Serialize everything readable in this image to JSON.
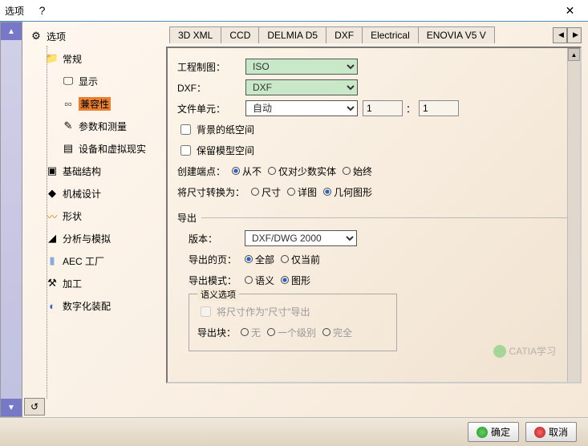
{
  "window": {
    "title": "选项",
    "help": "?",
    "close": "✕"
  },
  "tree": {
    "root": "选项",
    "general": "常规",
    "display": "显示",
    "compat": "兼容性",
    "params": "参数和测量",
    "devices": "设备和虚拟现实",
    "infra": "基础结构",
    "mech": "机械设计",
    "shape": "形状",
    "analysis": "分析与模拟",
    "aec": "AEC 工厂",
    "proc": "加工",
    "digit": "数字化装配"
  },
  "tabs": [
    "3D XML",
    "CCD",
    "DELMIA D5",
    "DXF",
    "Electrical",
    "ENOVIA V5 V"
  ],
  "form": {
    "drawing_label": "工程制图：",
    "drawing_value": "ISO",
    "dxf_label": "DXF：",
    "dxf_value": "DXF",
    "unit_label": "文件单元：",
    "unit_value": "自动",
    "unit_n1": "1",
    "unit_sep": "：",
    "unit_n2": "1",
    "bg_paper": "背景的纸空间",
    "keep_model": "保留模型空间",
    "create_ep": "创建端点：",
    "ep_opts": [
      "从不",
      "仅对少数实体",
      "始终"
    ],
    "convert_dim": "将尺寸转换为：",
    "dim_opts": [
      "尺寸",
      "详图",
      "几何图形"
    ],
    "export_title": "导出",
    "version_label": "版本：",
    "version_value": "DXF/DWG 2000",
    "pages_label": "导出的页：",
    "pages_opts": [
      "全部",
      "仅当前"
    ],
    "mode_label": "导出模式：",
    "mode_opts": [
      "语义",
      "图形"
    ],
    "sem_title": "语义选项",
    "sem_chk": "将尺寸作为\"尺寸\"导出",
    "block_label": "导出块：",
    "block_opts": [
      "无",
      "一个级别",
      "完全"
    ]
  },
  "footer": {
    "ok": "确定",
    "cancel": "取消"
  },
  "watermark": "CATIA学习"
}
